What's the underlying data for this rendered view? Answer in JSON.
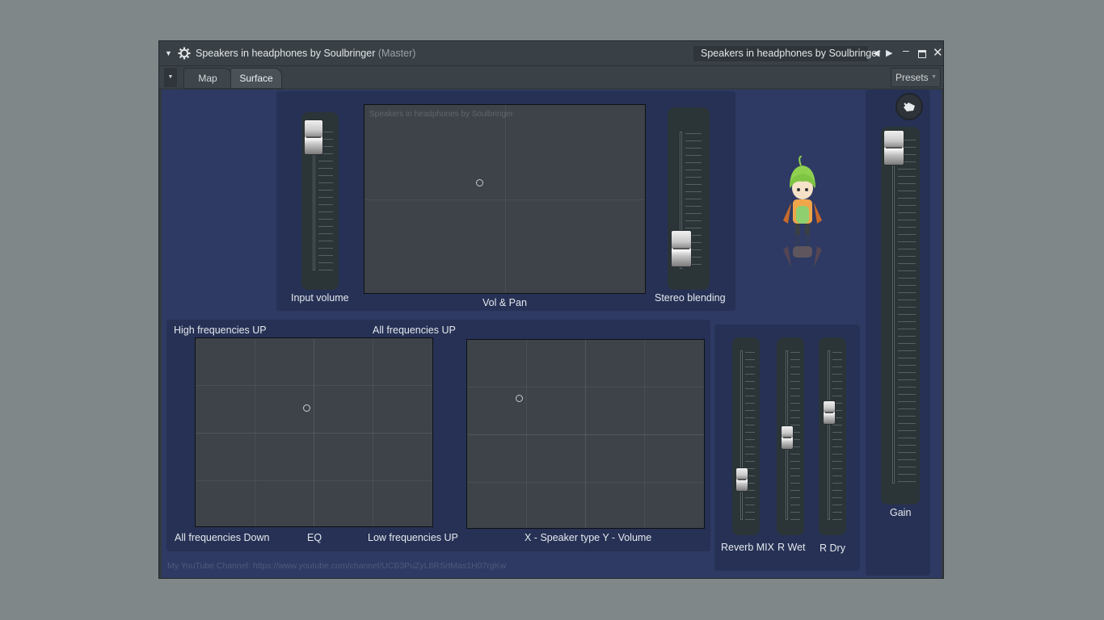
{
  "window": {
    "title": "Speakers in headphones by Soulbringer",
    "title_suffix": "(Master)",
    "right_title": "Speakers in headphones by Soulbringer"
  },
  "tabs": {
    "map": "Map",
    "surface": "Surface",
    "presets": "Presets"
  },
  "top_panel": {
    "input_volume_label": "Input volume",
    "vol_pan_label": "Vol & Pan",
    "vol_pan_watermark": "Speakers in headphones by Soulbringer",
    "stereo_blending_label": "Stereo blending",
    "input_volume_level": 0.9,
    "stereo_blending_level": 0.13
  },
  "eq_panel": {
    "top_left": "High frequencies UP",
    "top_right": "All frequencies UP",
    "bottom_left": "All frequencies Down",
    "bottom_center": "EQ",
    "bottom_right": "Low frequencies UP"
  },
  "speaker_panel": {
    "label": "X - Speaker type Y - Volume"
  },
  "reverb": {
    "mix_label": "Reverb MIX",
    "wet_label": "R Wet",
    "dry_label": "R Dry",
    "mix_level": 0.22,
    "wet_level": 0.47,
    "dry_level": 0.62
  },
  "gain": {
    "label": "Gain",
    "level": 0.96
  },
  "footer": {
    "link_text": "My YouTube Channel: https://www.youtube.com/channel/UCB3PuZyL8RSrtMas1H07rgKw"
  },
  "colors": {
    "surface": "#2e3a63",
    "panel": "#263155",
    "pad": "#3d4349",
    "label": "#e6e9ee"
  }
}
